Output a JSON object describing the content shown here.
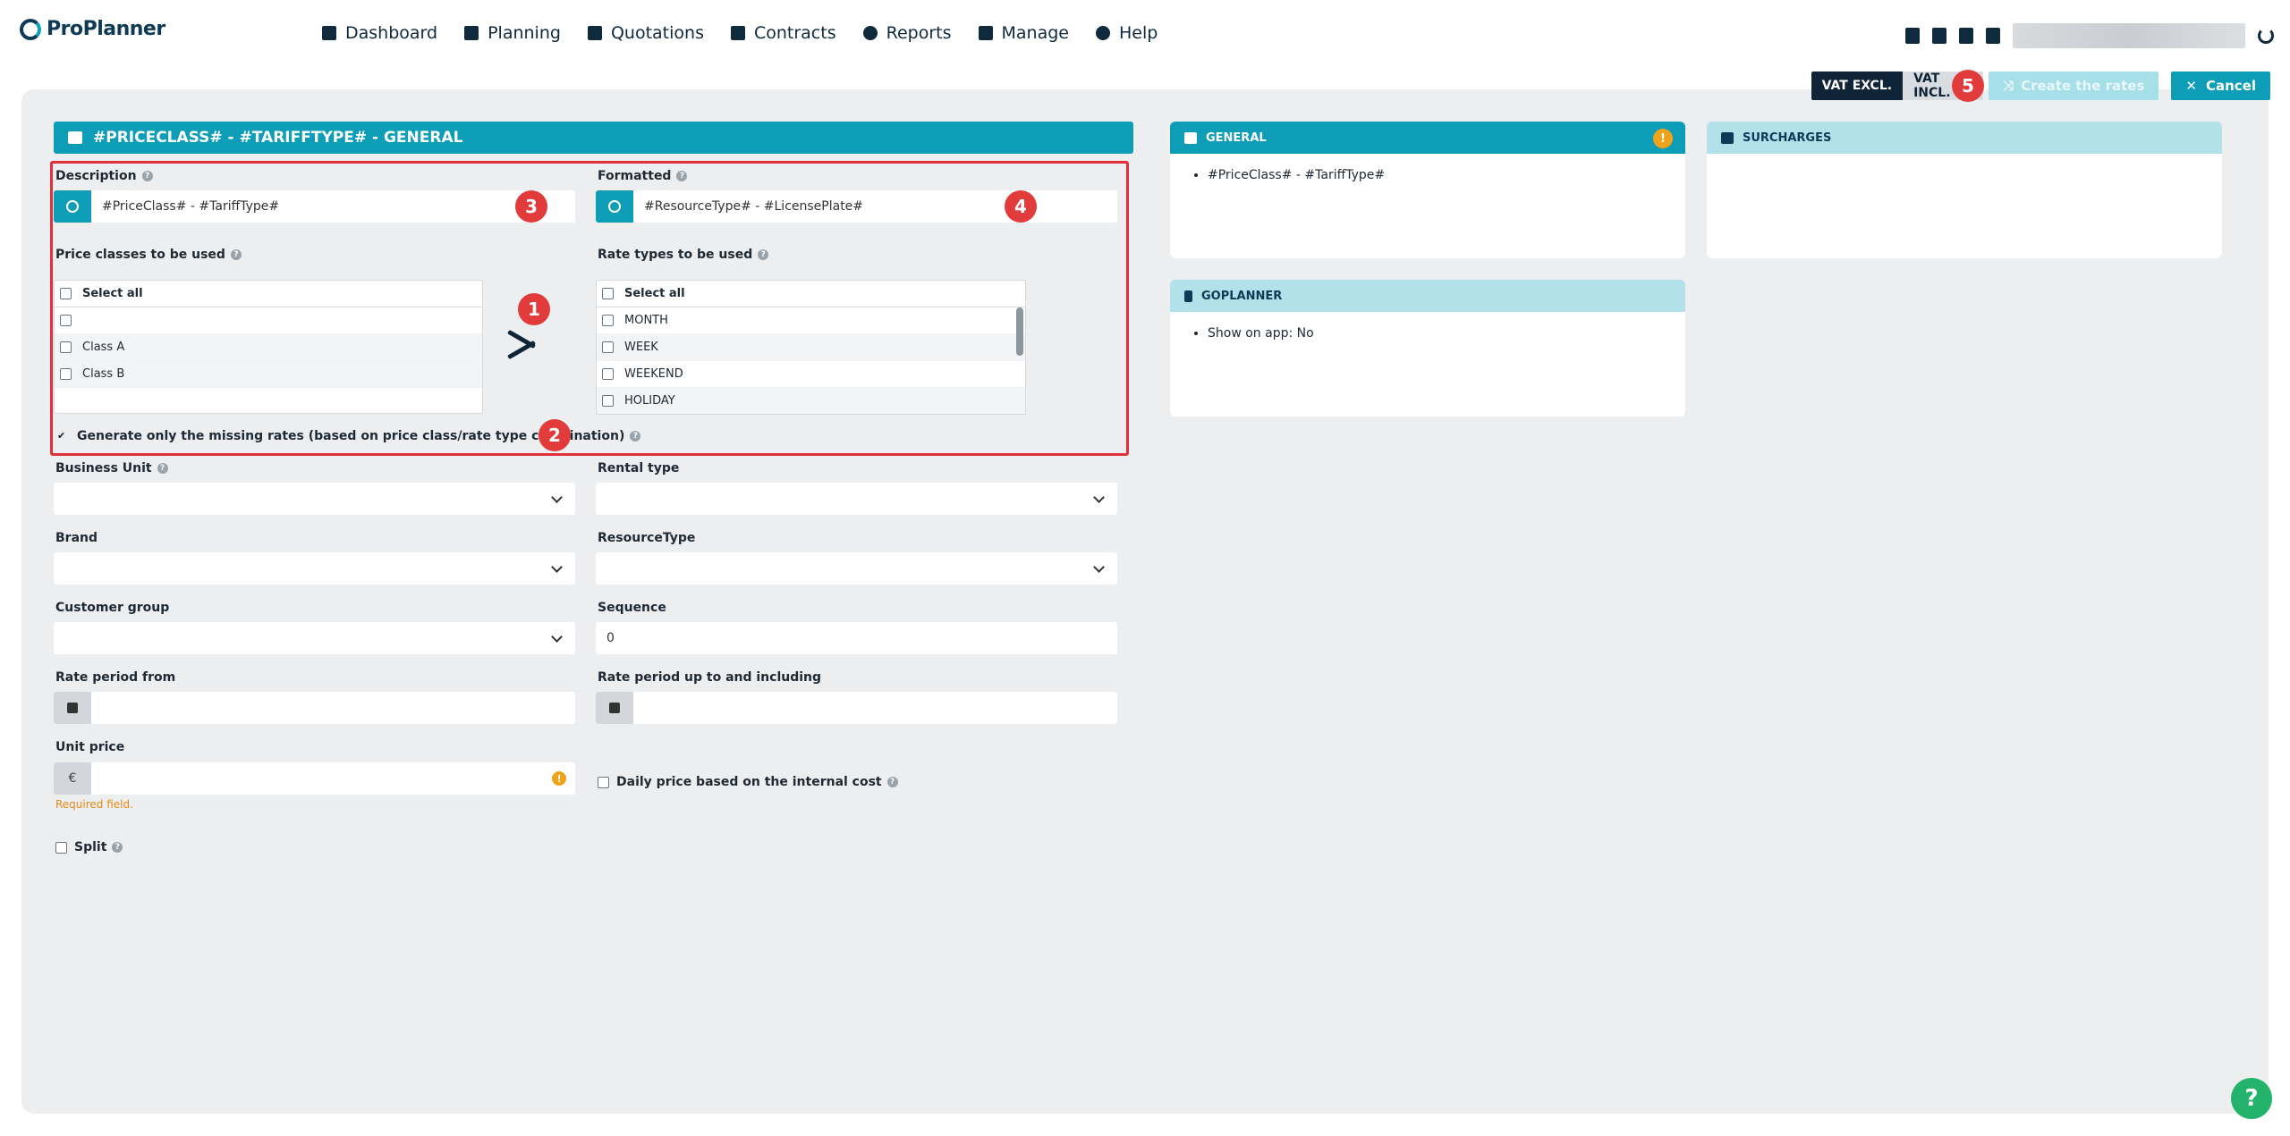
{
  "app": {
    "logo": "ProPlanner"
  },
  "nav": [
    {
      "label": "Dashboard"
    },
    {
      "label": "Planning"
    },
    {
      "label": "Quotations"
    },
    {
      "label": "Contracts"
    },
    {
      "label": "Reports"
    },
    {
      "label": "Manage"
    },
    {
      "label": "Help"
    }
  ],
  "toolbar": {
    "vat_excl": "VAT EXCL.",
    "vat_incl": "VAT INCL.",
    "create": "Create the rates",
    "cancel": "Cancel"
  },
  "header": {
    "title": "#PRICECLASS# - #TARIFFTYPE# - GENERAL"
  },
  "form": {
    "description": {
      "label": "Description",
      "value": "#PriceClass# - #TariffType#"
    },
    "formatted": {
      "label": "Formatted",
      "value": "#ResourceType# - #LicensePlate#"
    },
    "price_classes": {
      "label": "Price classes to be used",
      "select_all": "Select all",
      "items": [
        "",
        "Class A",
        "Class B"
      ]
    },
    "rate_types": {
      "label": "Rate types to be used",
      "select_all": "Select all",
      "items": [
        "MONTH",
        "WEEK",
        "WEEKEND",
        "HOLIDAY"
      ]
    },
    "missing_only": {
      "label": "Generate only the missing rates (based on price class/rate type combination)",
      "checked": true
    },
    "business_unit": {
      "label": "Business Unit",
      "value": ""
    },
    "rental_type": {
      "label": "Rental type",
      "value": ""
    },
    "brand": {
      "label": "Brand",
      "value": ""
    },
    "resource_type": {
      "label": "ResourceType",
      "value": ""
    },
    "customer_group": {
      "label": "Customer group",
      "value": ""
    },
    "sequence": {
      "label": "Sequence",
      "value": "0"
    },
    "rate_from": {
      "label": "Rate period from",
      "value": ""
    },
    "rate_to": {
      "label": "Rate period up to and including",
      "value": ""
    },
    "unit_price": {
      "label": "Unit price",
      "currency": "€",
      "value": "",
      "error": "Required field."
    },
    "daily_price": {
      "label": "Daily price based on the internal cost",
      "checked": false
    },
    "split": {
      "label": "Split",
      "checked": false
    }
  },
  "badges": [
    "1",
    "2",
    "3",
    "4",
    "5"
  ],
  "cards": {
    "general": {
      "title": "GENERAL",
      "items": [
        "#PriceClass# - #TariffType#"
      ]
    },
    "surcharges": {
      "title": "SURCHARGES"
    },
    "goplanner": {
      "title": "GOPLANNER",
      "items": [
        "Show on app: No"
      ]
    }
  },
  "help_fab": "?",
  "colors": {
    "accent": "#0d9db7",
    "dark": "#0f2436",
    "annotation": "#e23b3b",
    "warning": "#f0a31a",
    "help": "#23b36a"
  }
}
